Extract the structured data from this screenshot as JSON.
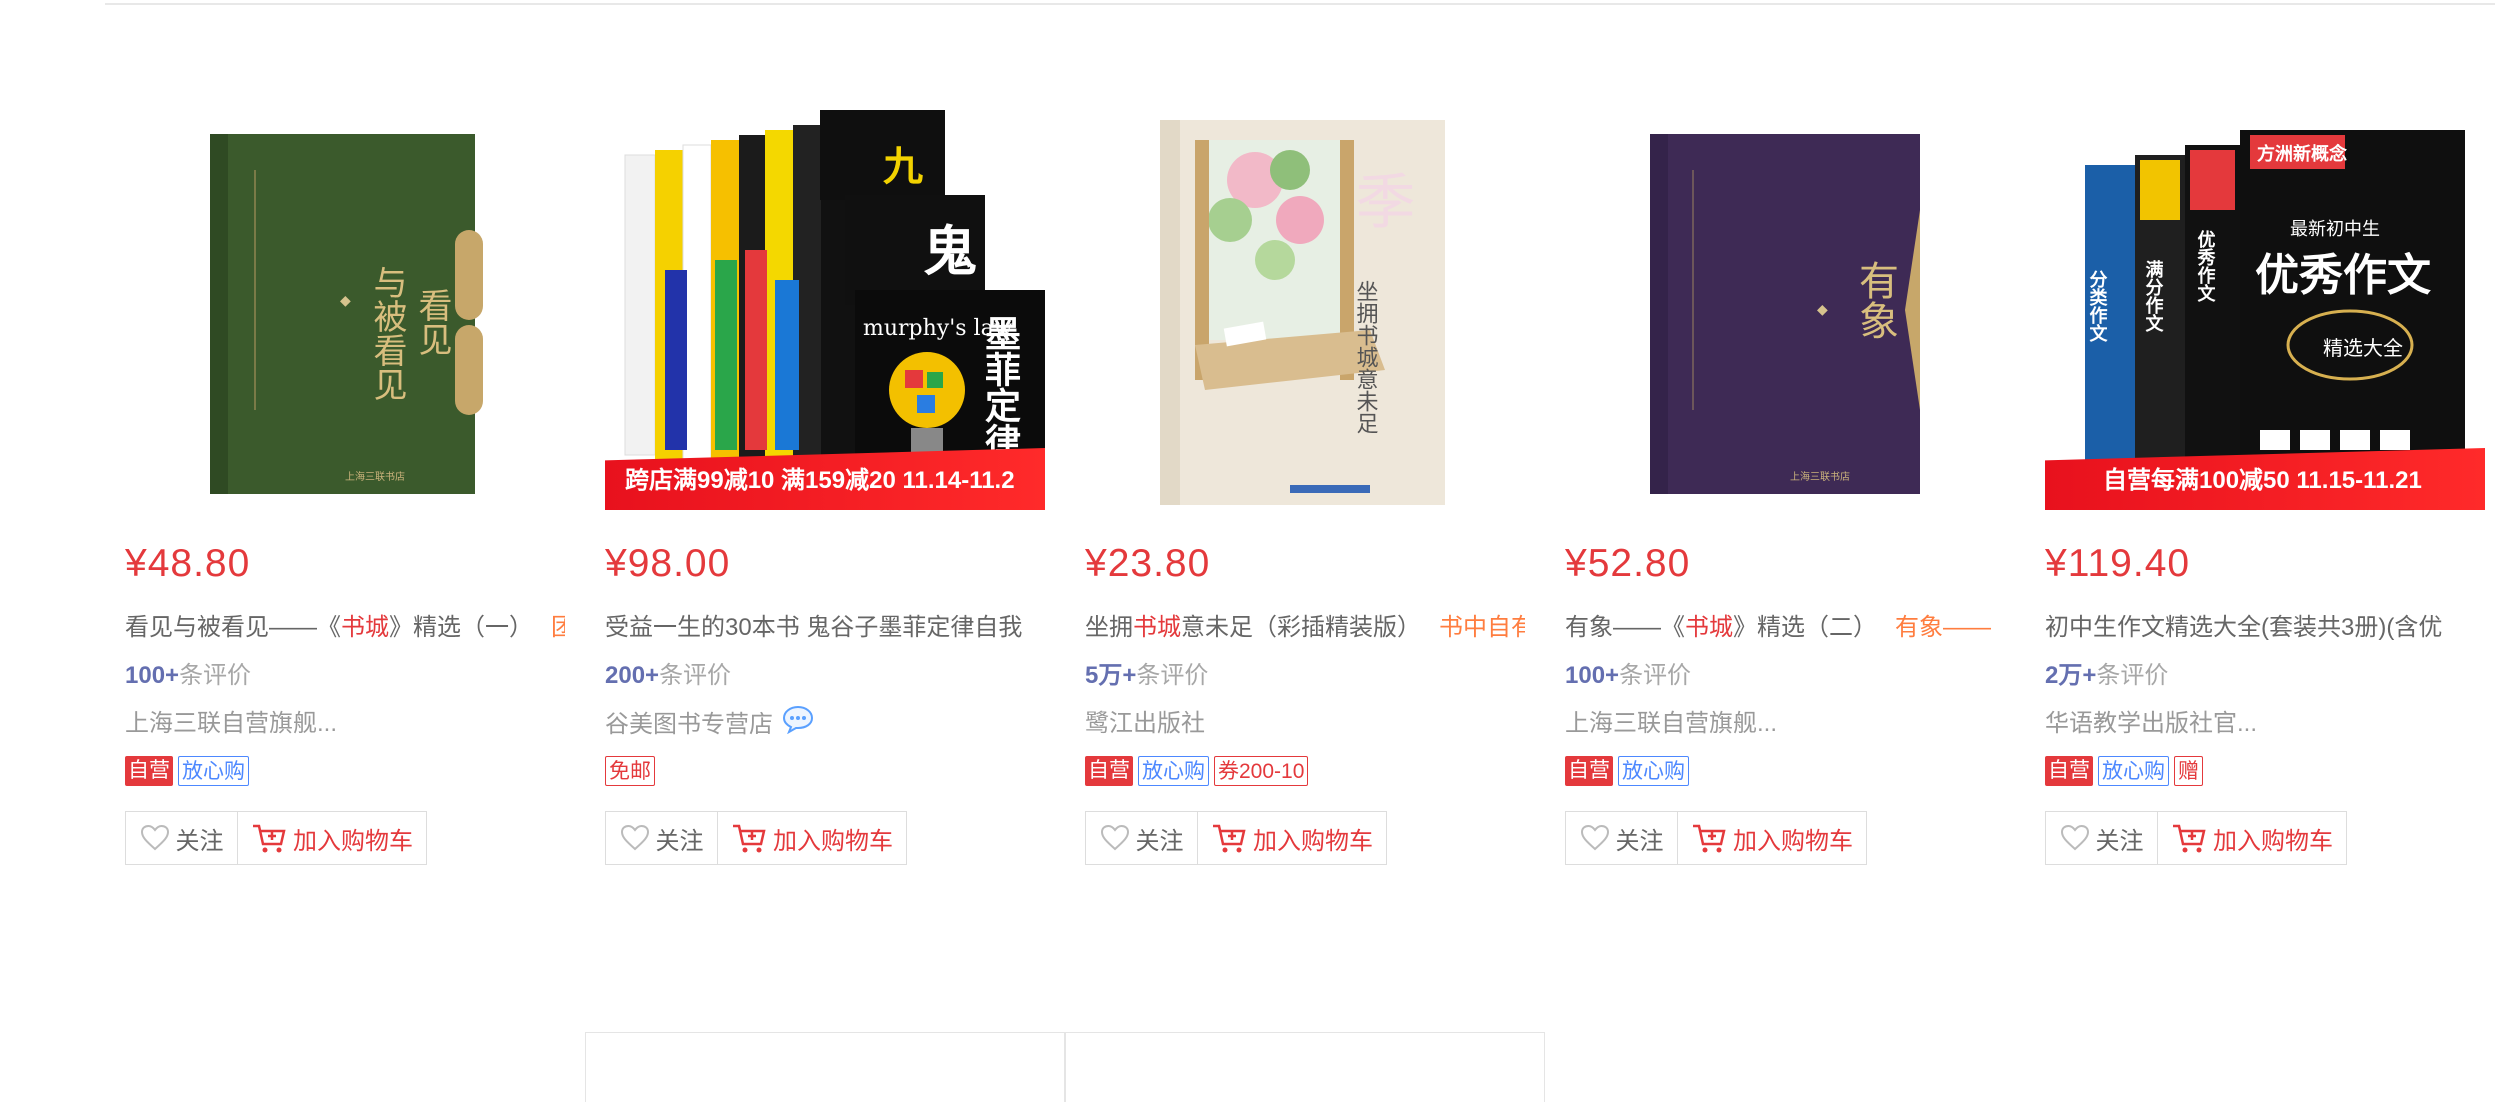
{
  "products": [
    {
      "price": "¥48.80",
      "title_pre": "看见与被看见——《",
      "title_hl": "书城",
      "title_post": "》精选（一）",
      "title_promo": "团",
      "rating_num": "100+",
      "rating_label": "条评价",
      "shop": "上海三联自营旗舰...",
      "tags": [
        "自营",
        "放心购"
      ],
      "follow_label": "关注",
      "cart_label": "加入购物车",
      "cover_text": "与被看见",
      "cover_text2": "看见",
      "cover_color": "#3b5a2c"
    },
    {
      "price": "¥98.00",
      "title_pre": "受益一生的30本书 鬼谷子墨菲定律自我",
      "shop": "谷美图书专营店",
      "rating_num": "200+",
      "rating_label": "条评价",
      "tags": [
        "免邮"
      ],
      "follow_label": "关注",
      "cart_label": "加入购物车",
      "ribbon": "跨店满99减10 满159减20 11.14-11.2",
      "cover_texts": [
        "九",
        "鬼",
        "murphy's law",
        "墨菲定律"
      ]
    },
    {
      "price": "¥23.80",
      "title_pre": "坐拥",
      "title_hl": "书城",
      "title_post": "意未足（彩插精装版）",
      "title_promo": "书中自有",
      "rating_num": "5万+",
      "rating_label": "条评价",
      "shop": "鹭江出版社",
      "tags": [
        "自营",
        "放心购",
        "券200-10"
      ],
      "follow_label": "关注",
      "cart_label": "加入购物车",
      "cover_text": "坐拥书城意未足"
    },
    {
      "price": "¥52.80",
      "title_pre": "有象——《",
      "title_hl": "书城",
      "title_post": "》精选（二）",
      "title_promo": "有象——",
      "rating_num": "100+",
      "rating_label": "条评价",
      "shop": "上海三联自营旗舰...",
      "tags": [
        "自营",
        "放心购"
      ],
      "follow_label": "关注",
      "cart_label": "加入购物车",
      "cover_text": "有象",
      "cover_color": "#3e2a55"
    },
    {
      "price": "¥119.40",
      "title_pre": "初中生作文精选大全(套装共3册)(含优",
      "rating_num": "2万+",
      "rating_label": "条评价",
      "shop": "华语教学出版社官...",
      "tags": [
        "自营",
        "放心购",
        "赠"
      ],
      "follow_label": "关注",
      "cart_label": "加入购物车",
      "ribbon": "自营每满100减50 11.15-11.21",
      "cover_texts": [
        "方洲新概念",
        "最新初中生",
        "优秀作文",
        "精选大全",
        "分类作文",
        "满分作文",
        "优秀作文"
      ]
    }
  ],
  "colors": {
    "price": "#e4393c",
    "rating_num": "#646fb0",
    "promo": "#ff7d3f",
    "tag_blue": "#4d88ff"
  }
}
